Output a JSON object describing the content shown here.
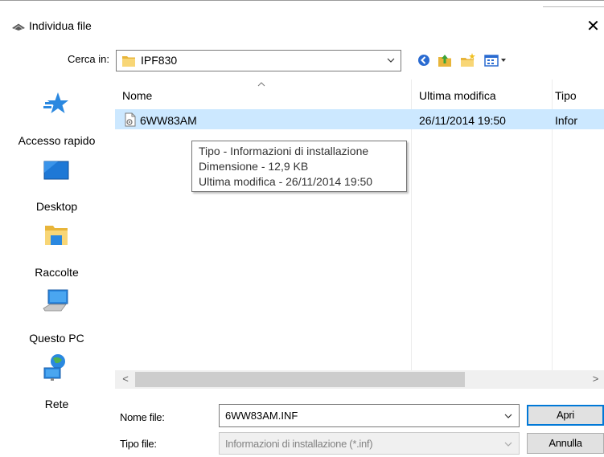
{
  "window": {
    "title": "Individua file",
    "close_glyph": "✕"
  },
  "look_in": {
    "label": "Cerca in:",
    "value": "IPF830"
  },
  "toolbar": {
    "icons": [
      "back-icon",
      "up-folder-icon",
      "new-folder-icon",
      "view-menu-icon"
    ]
  },
  "places": [
    {
      "label": "Accesso rapido",
      "icon": "quick-access-star-icon"
    },
    {
      "label": "Desktop",
      "icon": "desktop-icon"
    },
    {
      "label": "Raccolte",
      "icon": "libraries-folder-icon"
    },
    {
      "label": "Questo PC",
      "icon": "computer-icon"
    },
    {
      "label": "Rete",
      "icon": "network-icon"
    }
  ],
  "file_list": {
    "columns": [
      "Nome",
      "Ultima modifica",
      "Tipo"
    ],
    "rows": [
      {
        "name": "6WW83AM",
        "modified": "26/11/2014 19:50",
        "type": "Infor"
      }
    ]
  },
  "tooltip": {
    "lines": [
      "Tipo - Informazioni di installazione",
      "Dimensione - 12,9 KB",
      "Ultima modifica - 26/11/2014 19:50"
    ]
  },
  "scrollbar": {
    "left_glyph": "<",
    "right_glyph": ">"
  },
  "bottom": {
    "filename_label": "Nome file:",
    "filename_value": "6WW83AM.INF",
    "filetype_label": "Tipo file:",
    "filetype_value": "Informazioni di installazione (*.inf)",
    "open_label": "Apri",
    "cancel_label": "Annulla"
  },
  "colors": {
    "selection": "#cce8ff",
    "focus_border": "#0078d7",
    "button_face": "#e1e1e1"
  }
}
